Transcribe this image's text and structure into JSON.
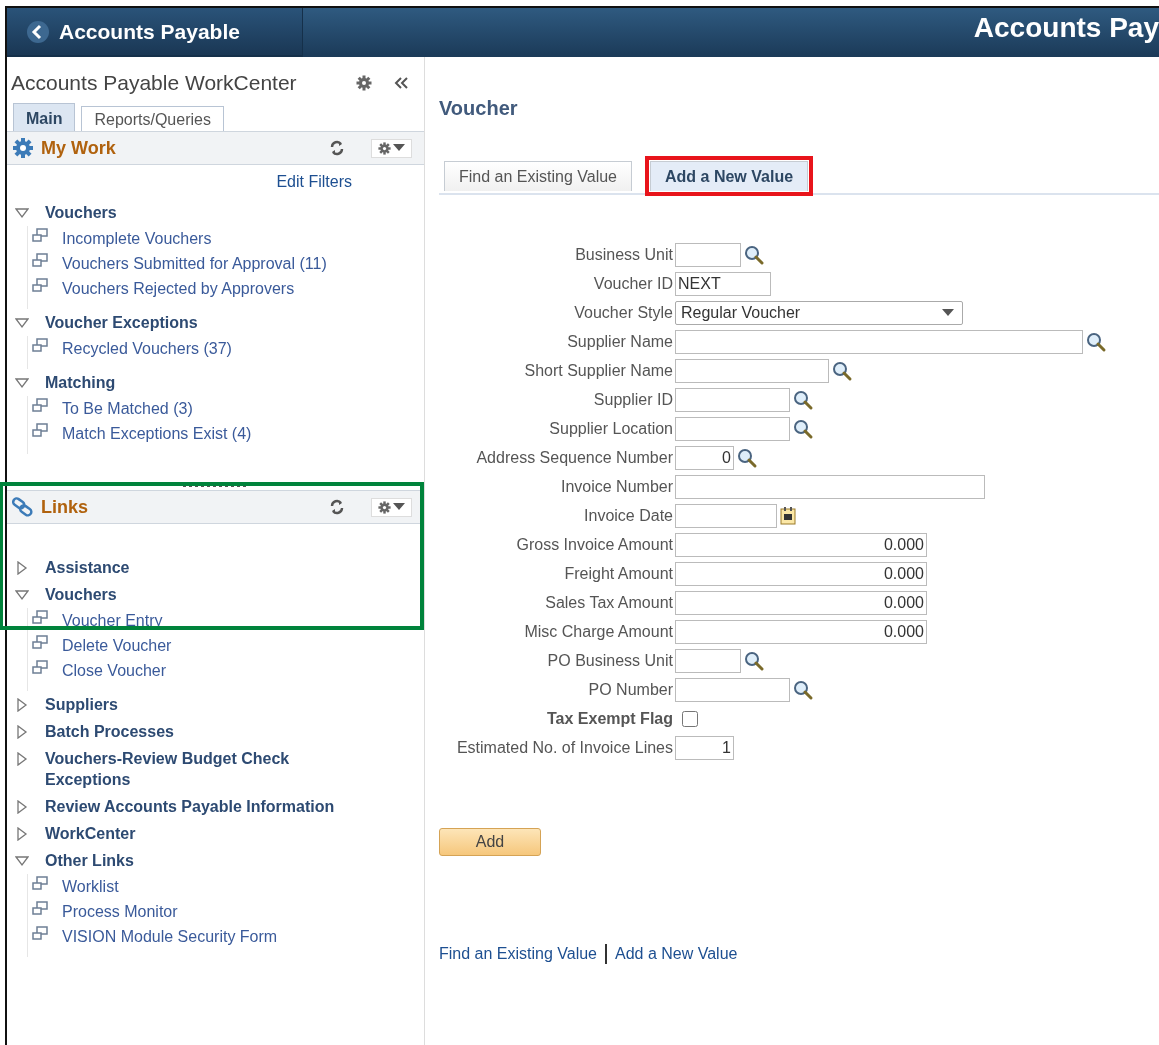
{
  "header": {
    "back_label": "Accounts Payable",
    "title": "Accounts Pay"
  },
  "workcenter": {
    "title": "Accounts Payable WorkCenter",
    "tabs": [
      {
        "label": "Main",
        "selected": true
      },
      {
        "label": "Reports/Queries",
        "selected": false
      }
    ],
    "my_work": {
      "title": "My Work",
      "edit_filters": "Edit Filters",
      "groups": [
        {
          "label": "Vouchers",
          "expanded": true,
          "items": [
            "Incomplete Vouchers",
            "Vouchers Submitted for Approval (11)",
            "Vouchers Rejected by Approvers"
          ]
        },
        {
          "label": "Voucher Exceptions",
          "expanded": true,
          "items": [
            "Recycled Vouchers (37)"
          ]
        },
        {
          "label": "Matching",
          "expanded": true,
          "items": [
            "To Be Matched (3)",
            "Match Exceptions Exist (4)"
          ]
        }
      ]
    },
    "links": {
      "title": "Links",
      "highlighted": true,
      "groups": [
        {
          "label": "Assistance",
          "expanded": false
        },
        {
          "label": "Vouchers",
          "expanded": true,
          "items": [
            "Voucher Entry",
            "Delete Voucher",
            "Close Voucher"
          ]
        },
        {
          "label": "Suppliers",
          "expanded": false
        },
        {
          "label": "Batch Processes",
          "expanded": false
        },
        {
          "label": "Vouchers-Review Budget Check Exceptions",
          "expanded": false
        },
        {
          "label": "Review Accounts Payable Information",
          "expanded": false
        },
        {
          "label": "WorkCenter",
          "expanded": false
        },
        {
          "label": "Other Links",
          "expanded": true,
          "items": [
            "Worklist",
            "Process Monitor",
            "VISION Module Security Form"
          ]
        }
      ]
    }
  },
  "page": {
    "title": "Voucher",
    "tabs": [
      {
        "label": "Find an Existing Value",
        "selected": false,
        "highlighted": false
      },
      {
        "label": "Add a New Value",
        "selected": true,
        "highlighted": true
      }
    ],
    "fields": [
      {
        "label": "Business Unit",
        "kind": "lookup"
      },
      {
        "label": "Voucher ID",
        "kind": "text",
        "value": "NEXT"
      },
      {
        "label": "Voucher Style",
        "kind": "select",
        "value": "Regular Voucher"
      },
      {
        "label": "Supplier Name",
        "kind": "lookup"
      },
      {
        "label": "Short Supplier Name",
        "kind": "lookup"
      },
      {
        "label": "Supplier ID",
        "kind": "lookup"
      },
      {
        "label": "Supplier Location",
        "kind": "lookup"
      },
      {
        "label": "Address Sequence Number",
        "kind": "lookup",
        "value": "0"
      },
      {
        "label": "Invoice Number",
        "kind": "text"
      },
      {
        "label": "Invoice Date",
        "kind": "date"
      },
      {
        "label": "Gross Invoice Amount",
        "kind": "number",
        "value": "0.000"
      },
      {
        "label": "Freight Amount",
        "kind": "number",
        "value": "0.000"
      },
      {
        "label": "Sales Tax Amount",
        "kind": "number",
        "value": "0.000"
      },
      {
        "label": "Misc Charge Amount",
        "kind": "number",
        "value": "0.000"
      },
      {
        "label": "PO Business Unit",
        "kind": "lookup"
      },
      {
        "label": "PO Number",
        "kind": "lookup"
      },
      {
        "label": "Tax Exempt Flag",
        "kind": "checkbox",
        "checked": false
      },
      {
        "label": "Estimated No. of Invoice Lines",
        "kind": "number",
        "value": "1"
      }
    ],
    "add_button": "Add",
    "bottom_links": [
      "Find an Existing Value",
      "Add a New Value"
    ]
  }
}
